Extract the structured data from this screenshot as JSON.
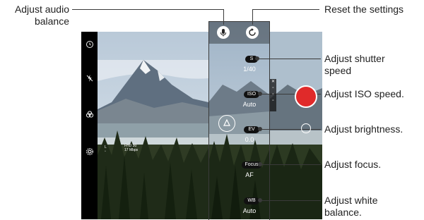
{
  "callouts": {
    "audio_balance": [
      "Adjust audio",
      "balance"
    ],
    "reset_settings": "Reset the settings",
    "shutter_speed": [
      "Adjust shutter",
      "speed"
    ],
    "iso_speed": "Adjust ISO speed.",
    "brightness": "Adjust brightness.",
    "focus": "Adjust focus.",
    "white_balance": [
      "Adjust white",
      "balance."
    ]
  },
  "controls": {
    "shutter_label": "S",
    "shutter_value": "1/40",
    "iso_label": "ISO",
    "iso_value": "Auto",
    "ev_label": "EV",
    "ev_value": "0.0",
    "focus_label": "Focus",
    "focus_value": "AF",
    "wb_label": "WB",
    "wb_value": "Auto"
  },
  "info_overlay": {
    "res_line1": "FHD 30",
    "res_line2": "17 Mbps"
  },
  "icons": {
    "mic": "microphone-icon",
    "reset": "reset-icon",
    "timer": "timer-icon",
    "flash_off": "flash-off-icon",
    "effects": "effects-icon",
    "settings": "gear-icon",
    "focus_peak": "focus-peaking-icon"
  },
  "colors": {
    "shutter_button": "#e02a2a",
    "callout_line": "#3a3a3a"
  }
}
